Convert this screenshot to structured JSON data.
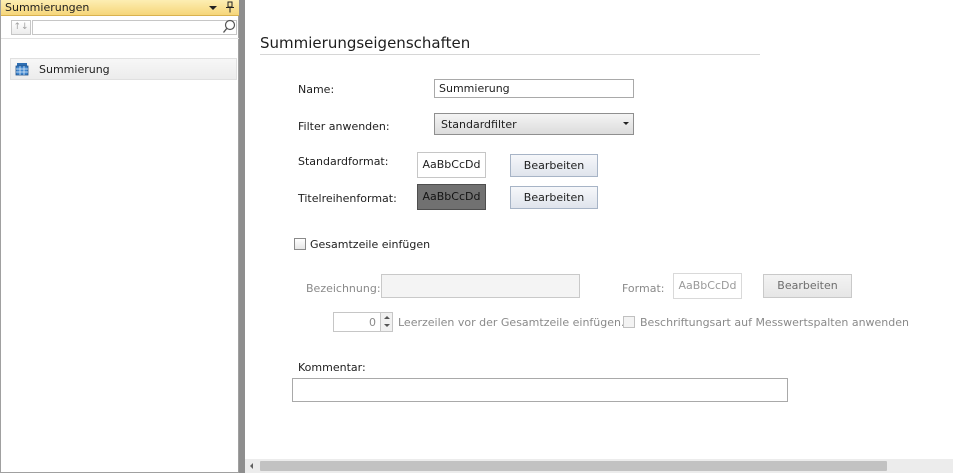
{
  "sidebar": {
    "title": "Summierungen",
    "sort_label": "↑↓",
    "items": [
      {
        "label": "Summierung"
      }
    ]
  },
  "main": {
    "title": "Summierungseigenschaften",
    "name_label": "Name:",
    "name_value": "Summierung",
    "filter_label": "Filter anwenden:",
    "filter_value": "Standardfilter",
    "standard_format_label": "Standardformat:",
    "standard_format_sample": "AaBbCcDd",
    "title_row_format_label": "Titelreihenformat:",
    "title_row_format_sample": "AaBbCcDd",
    "edit_label": "Bearbeiten",
    "total_row_checkbox_label": "Gesamtzeile einfügen",
    "designation_label": "Bezeichnung:",
    "designation_value": "",
    "format_label": "Format:",
    "format_sample": "AaBbCcDd",
    "format_edit_label": "Bearbeiten",
    "empty_rows_value": "0",
    "empty_rows_label": "Leerzeilen vor der Gesamtzeile einfügen.",
    "label_style_checkbox_label": "Beschriftungsart auf Messwertspalten anwenden",
    "comment_label": "Kommentar:",
    "comment_value": ""
  },
  "colors": {
    "header_accent": "#f6d67a",
    "splitter": "#8e8e8e",
    "title_format_bg": "#717171",
    "button_border": "#a7b4c6"
  }
}
